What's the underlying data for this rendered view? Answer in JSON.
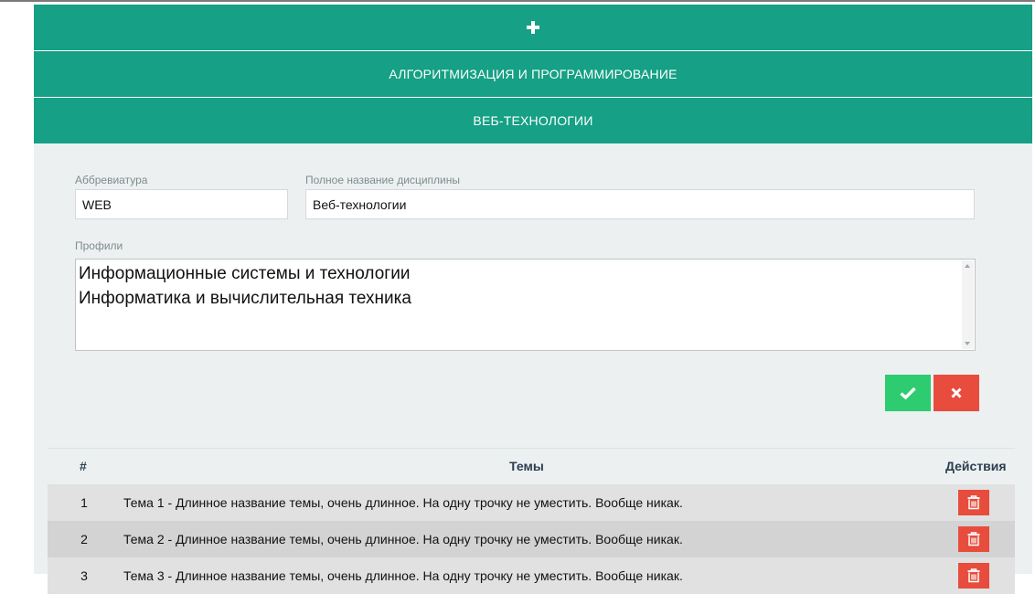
{
  "accordion": {
    "add_label": "+",
    "items": [
      {
        "label": "АЛГОРИТМИЗАЦИЯ И ПРОГРАММИРОВАНИЕ"
      },
      {
        "label": "ВЕБ-ТЕХНОЛОГИИ"
      }
    ]
  },
  "form": {
    "abbr_label": "Аббревиатура",
    "abbr_value": "WEB",
    "fullname_label": "Полное название дисциплины",
    "fullname_value": "Веб-технологии",
    "profiles_label": "Профили",
    "profiles_lines": [
      "Информационные системы и технологии",
      "Информатика и вычислительная техника"
    ],
    "confirm_icon": "check-icon",
    "cancel_icon": "close-icon"
  },
  "topics_table": {
    "columns": [
      "#",
      "Темы",
      "Действия"
    ],
    "rows": [
      {
        "num": "1",
        "title": "Тема 1 - Длинное название темы, очень длинное. На одну трочку не уместить. Вообще никак."
      },
      {
        "num": "2",
        "title": "Тема 2 - Длинное название темы, очень длинное. На одну трочку не уместить. Вообще никак."
      },
      {
        "num": "3",
        "title": "Тема 3 - Длинное название темы, очень длинное. На одну трочку не уместить. Вообще никак."
      }
    ],
    "row_action_icon": "trash-icon"
  },
  "colors": {
    "accordion_bg": "#16a085",
    "panel_bg": "#ecf0f1",
    "confirm": "#2ecc71",
    "danger": "#e74c3c"
  }
}
